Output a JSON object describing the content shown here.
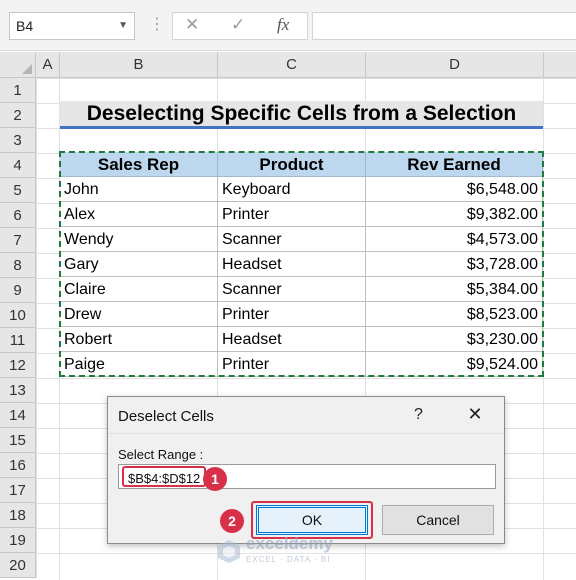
{
  "formula_bar": {
    "name_box": "B4",
    "cancel_glyph": "✕",
    "enter_glyph": "✓",
    "fx_label": "fx",
    "formula": ""
  },
  "columns": [
    "A",
    "B",
    "C",
    "D"
  ],
  "rows": [
    "1",
    "2",
    "3",
    "4",
    "5",
    "6",
    "7",
    "8",
    "9",
    "10",
    "11",
    "12",
    "13",
    "14",
    "15",
    "16",
    "17",
    "18",
    "19",
    "20"
  ],
  "sheet": {
    "title": "Deselecting Specific Cells from a Selection",
    "headers": [
      "Sales Rep",
      "Product",
      "Rev Earned"
    ],
    "data": [
      [
        "John",
        "Keyboard",
        "$6,548.00"
      ],
      [
        "Alex",
        "Printer",
        "$9,382.00"
      ],
      [
        "Wendy",
        "Scanner",
        "$4,573.00"
      ],
      [
        "Gary",
        "Headset",
        "$3,728.00"
      ],
      [
        "Claire",
        "Scanner",
        "$5,384.00"
      ],
      [
        "Drew",
        "Printer",
        "$8,523.00"
      ],
      [
        "Robert",
        "Headset",
        "$3,230.00"
      ],
      [
        "Paige",
        "Printer",
        "$9,524.00"
      ]
    ]
  },
  "dialog": {
    "title": "Deselect Cells",
    "help_label": "?",
    "close_glyph": "✕",
    "range_label": "Select Range :",
    "range_value": "$B$4:$D$12",
    "ok_label": "OK",
    "cancel_label": "Cancel",
    "step_badges": [
      "1",
      "2"
    ]
  },
  "watermark": {
    "name": "exceldemy",
    "tagline": "EXCEL · DATA · BI"
  },
  "colors": {
    "header_fill": "#bdd7ee",
    "title_fill": "#e7e6e6",
    "title_underline": "#4472c4",
    "marquee": "#1f7a3f",
    "callout_red": "#d9304a"
  }
}
